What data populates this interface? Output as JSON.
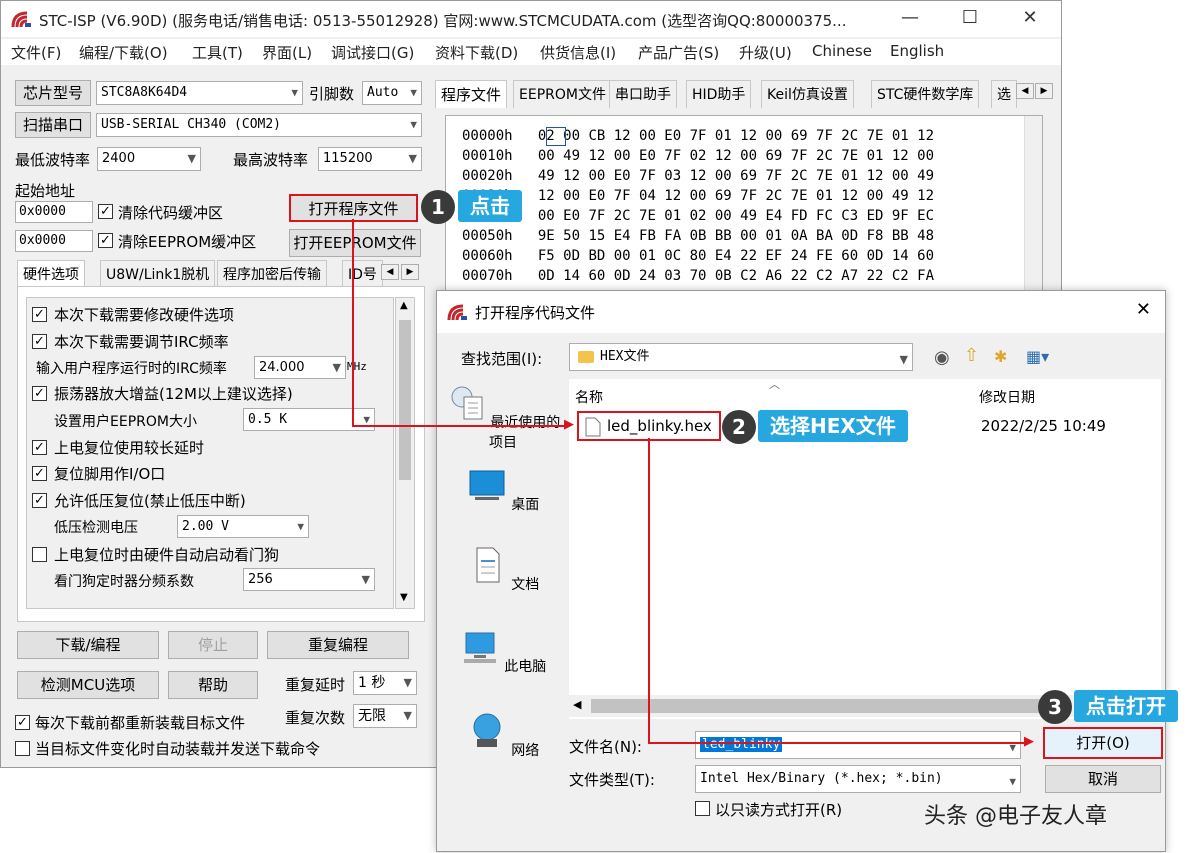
{
  "main": {
    "title": "STC-ISP (V6.90D) (服务电话/销售电话: 0513-55012928) 官网:www.STCMCUDATA.com  (选型咨询QQ:80000375...",
    "window_controls": {
      "minimize": "—",
      "maximize": "☐",
      "close": "✕"
    },
    "menu": [
      "文件(F)",
      "编程/下载(O)",
      "工具(T)",
      "界面(L)",
      "调试接口(G)",
      "资料下载(D)",
      "供货信息(I)",
      "产品广告(S)",
      "升级(U)",
      "Chinese",
      "English"
    ],
    "chip_btn": "芯片型号",
    "chip_value": "STC8A8K64D4",
    "pin_label": "引脚数",
    "pin_value": "Auto",
    "scan_btn": "扫描串口",
    "port_value": "USB-SERIAL CH340 (COM2)",
    "min_baud_label": "最低波特率",
    "min_baud_value": "2400",
    "max_baud_label": "最高波特率",
    "max_baud_value": "115200",
    "start_addr_label": "起始地址",
    "addr1": "0x0000",
    "clear_code": "清除代码缓冲区",
    "open_prog_btn": "打开程序文件",
    "addr2": "0x0000",
    "clear_eeprom": "清除EEPROM缓冲区",
    "open_eeprom_btn": "打开EEPROM文件",
    "left_tabs": [
      "硬件选项",
      "U8W/Link1脱机",
      "程序加密后传输",
      "ID号"
    ],
    "options": {
      "opt1": "本次下载需要修改硬件选项",
      "opt2": "本次下载需要调节IRC频率",
      "irc_label": "输入用户程序运行时的IRC频率",
      "irc_value": "24.000",
      "irc_unit": "MHz",
      "opt3": "振荡器放大增益(12M以上建议选择)",
      "eeprom_size_label": "设置用户EEPROM大小",
      "eeprom_size_value": "0.5 K",
      "opt4": "上电复位使用较长延时",
      "opt5": "复位脚用作I/O口",
      "opt6": "允许低压复位(禁止低压中断)",
      "lvd_label": "低压检测电压",
      "lvd_value": "2.00 V",
      "opt7": "上电复位时由硬件自动启动看门狗",
      "wdt_label": "看门狗定时器分频系数",
      "wdt_value": "256"
    },
    "download_btn": "下载/编程",
    "stop_btn": "停止",
    "reprogram_btn": "重复编程",
    "detect_btn": "检测MCU选项",
    "help_btn": "帮助",
    "repeat_delay_label": "重复延时",
    "repeat_delay_value": "1 秒",
    "repeat_count_label": "重复次数",
    "repeat_count_value": "无限",
    "reload_label": "每次下载前都重新装载目标文件",
    "auto_send_label": "当目标文件变化时自动装载并发送下载命令",
    "right_tabs": [
      "程序文件",
      "EEPROM文件",
      "串口助手",
      "HID助手",
      "Keil仿真设置",
      "STC硬件数学库",
      "选"
    ],
    "hex_rows": [
      {
        "addr": "00000h",
        "bytes": "02 00 CB 12 00 E0 7F 01 12 00 69 7F 2C 7E 01 12"
      },
      {
        "addr": "00010h",
        "bytes": "00 49 12 00 E0 7F 02 12 00 69 7F 2C 7E 01 12 00"
      },
      {
        "addr": "00020h",
        "bytes": "49 12 00 E0 7F 03 12 00 69 7F 2C 7E 01 12 00 49"
      },
      {
        "addr": "00030h",
        "bytes": "12 00 E0 7F 04 12 00 69 7F 2C 7E 01 12 00 49 12"
      },
      {
        "addr": "00040h",
        "bytes": "00 E0 7F 2C 7E 01 02 00 49 E4 FD FC C3 ED 9F EC"
      },
      {
        "addr": "00050h",
        "bytes": "9E 50 15 E4 FB FA 0B BB 00 01 0A BA 0D F8 BB 48"
      },
      {
        "addr": "00060h",
        "bytes": "F5 0D BD 00 01 0C 80 E4 22 EF 24 FE 60 0D 14 60"
      },
      {
        "addr": "00070h",
        "bytes": "0D 14 60 0D 24 03 70 0B C2 A6 22 C2 A7 22 C2 FA"
      }
    ]
  },
  "dialog": {
    "title": "打开程序代码文件",
    "close": "✕",
    "lookin_label": "查找范围(I):",
    "lookin_value": "HEX文件",
    "col_name": "名称",
    "col_date": "修改日期",
    "file_name": "led_blinky.hex",
    "file_date": "2022/2/25 10:49",
    "nav": [
      "最近使用的项目",
      "桌面",
      "文档",
      "此电脑",
      "网络"
    ],
    "filename_label": "文件名(N):",
    "filename_value": "led_blinky",
    "filetype_label": "文件类型(T):",
    "filetype_value": "Intel Hex/Binary (*.hex; *.bin)",
    "readonly_label": "以只读方式打开(R)",
    "open_btn": "打开(O)",
    "cancel_btn": "取消"
  },
  "callouts": {
    "step1_num": "1",
    "step1_text": "点击",
    "step2_num": "2",
    "step2_text": "选择HEX文件",
    "step3_num": "3",
    "step3_text": "点击打开"
  },
  "watermark": "头条 @电子友人章",
  "colors": {
    "callout_bg": "#26a7e0",
    "arrow_red": "#d9141e",
    "badge_bg": "#3a3a3a"
  }
}
